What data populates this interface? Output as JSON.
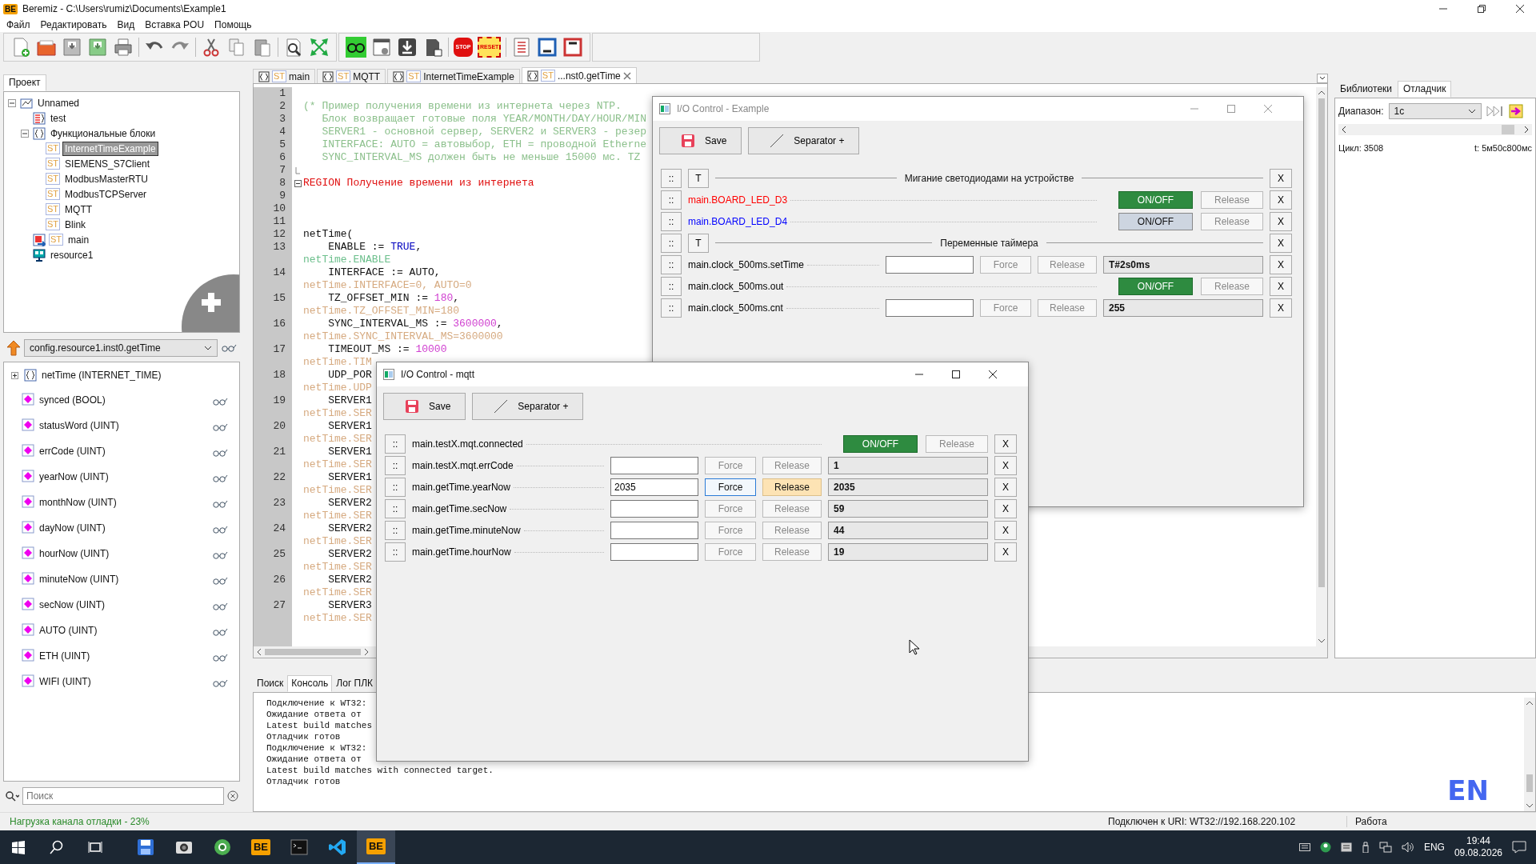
{
  "window": {
    "logo": "BE",
    "title": "Beremiz - C:\\Users\\rumiz\\Documents\\Example1"
  },
  "menu": [
    "Файл",
    "Редактировать",
    "Вид",
    "Вставка POU",
    "Помощь"
  ],
  "toolbar": {
    "stop_label": "STOP",
    "reset_label": "RESET"
  },
  "project_panel": {
    "tab": "Проект",
    "tree": [
      {
        "label": "Unnamed",
        "kind": "plc",
        "selected": false,
        "expanded": true,
        "children": [
          {
            "label": "test",
            "kind": "data",
            "selected": false
          },
          {
            "label": "Функциональные блоки",
            "kind": "folder",
            "selected": false,
            "expanded": true,
            "children": [
              {
                "label": "InternetTimeExample",
                "kind": "st",
                "badge": "ST",
                "selected": true
              },
              {
                "label": "SIEMENS_S7Client",
                "kind": "st",
                "badge": "ST",
                "selected": false
              },
              {
                "label": "ModbusMasterRTU",
                "kind": "st",
                "badge": "ST",
                "selected": false
              },
              {
                "label": "ModbusTCPServer",
                "kind": "st",
                "badge": "ST",
                "selected": false
              },
              {
                "label": "MQTT",
                "kind": "st",
                "badge": "ST",
                "selected": false
              },
              {
                "label": "Blink",
                "kind": "st",
                "badge": "ST",
                "selected": false
              }
            ]
          },
          {
            "label": "main",
            "kind": "program",
            "badge": "ST",
            "selected": false
          },
          {
            "label": "resource1",
            "kind": "resource",
            "selected": false
          }
        ]
      }
    ]
  },
  "instance": {
    "path": "config.resource1.inst0.getTime"
  },
  "variables": [
    {
      "label": "netTime (INTERNET_TIME)",
      "kind": "block",
      "expanded": false
    },
    {
      "label": "synced (BOOL)",
      "kind": "var"
    },
    {
      "label": "statusWord (UINT)",
      "kind": "var"
    },
    {
      "label": "errCode (UINT)",
      "kind": "var"
    },
    {
      "label": "yearNow (UINT)",
      "kind": "var"
    },
    {
      "label": "monthNow (UINT)",
      "kind": "var"
    },
    {
      "label": "dayNow (UINT)",
      "kind": "var"
    },
    {
      "label": "hourNow (UINT)",
      "kind": "var"
    },
    {
      "label": "minuteNow (UINT)",
      "kind": "var"
    },
    {
      "label": "secNow (UINT)",
      "kind": "var"
    },
    {
      "label": "AUTO (UINT)",
      "kind": "var"
    },
    {
      "label": "ETH (UINT)",
      "kind": "var"
    },
    {
      "label": "WIFI (UINT)",
      "kind": "var"
    }
  ],
  "search": {
    "placeholder": "Поиск"
  },
  "editor": {
    "tabs": [
      {
        "label": "main",
        "badge": "ST",
        "selected": false
      },
      {
        "label": "MQTT",
        "badge": "ST",
        "selected": false
      },
      {
        "label": "InternetTimeExample",
        "badge": "ST",
        "selected": false
      },
      {
        "label": "...nst0.getTime",
        "badge": "ST",
        "selected": true
      }
    ],
    "lines": [
      {
        "number": "1"
      },
      {
        "number": "2",
        "segments": [
          {
            "kind": "comment",
            "text": "(* Пример получения времени из интернета через NTP."
          }
        ]
      },
      {
        "number": "3",
        "segments": [
          {
            "kind": "comment",
            "text": "   Блок возвращает готовые поля YEAR/MONTH/DAY/HOUR/MIN"
          }
        ]
      },
      {
        "number": "4",
        "segments": [
          {
            "kind": "comment",
            "text": "   SERVER1 - основной сервер, SERVER2 и SERVER3 - резер"
          }
        ]
      },
      {
        "number": "5",
        "segments": [
          {
            "kind": "comment",
            "text": "   INTERFACE: AUTO = автовыбор, ETH = проводной Etherne"
          }
        ]
      },
      {
        "number": "6",
        "segments": [
          {
            "kind": "comment",
            "text": "   SYNC_INTERVAL_MS должен быть не меньше 15000 мс. TZ"
          }
        ]
      },
      {
        "number": "7",
        "kind": "fold_end"
      },
      {
        "number": "8",
        "kind": "fold_start",
        "segments": [
          {
            "kind": "region",
            "text": "REGION Получение времени из интернета"
          }
        ]
      },
      {
        "number": "9"
      },
      {
        "number": "10"
      },
      {
        "number": "11"
      },
      {
        "number": "12",
        "segments": [
          {
            "kind": "code",
            "text": "netTime("
          }
        ]
      },
      {
        "number": "13",
        "segments": [
          {
            "kind": "code",
            "text": "    ENABLE := "
          },
          {
            "kind": "keyword",
            "text": "TRUE"
          },
          {
            "kind": "code",
            "text": ","
          }
        ],
        "watch": {
          "kind": "bool",
          "text": "netTime.ENABLE"
        }
      },
      {
        "number": "14",
        "segments": [
          {
            "kind": "code",
            "text": "    INTERFACE := AUTO,"
          }
        ],
        "watch": {
          "kind": "value",
          "text": "netTime.INTERFACE=0, AUTO=0"
        }
      },
      {
        "number": "15",
        "segments": [
          {
            "kind": "code",
            "text": "    TZ_OFFSET_MIN := "
          },
          {
            "kind": "number",
            "text": "180"
          },
          {
            "kind": "code",
            "text": ","
          }
        ],
        "watch": {
          "kind": "value",
          "text": "netTime.TZ_OFFSET_MIN=180"
        }
      },
      {
        "number": "16",
        "segments": [
          {
            "kind": "code",
            "text": "    SYNC_INTERVAL_MS := "
          },
          {
            "kind": "number",
            "text": "3600000"
          },
          {
            "kind": "code",
            "text": ","
          }
        ],
        "watch": {
          "kind": "value",
          "text": "netTime.SYNC_INTERVAL_MS=3600000"
        }
      },
      {
        "number": "17",
        "segments": [
          {
            "kind": "code",
            "text": "    TIMEOUT_MS := "
          },
          {
            "kind": "number",
            "text": "10000"
          }
        ],
        "watch": {
          "kind": "value",
          "text": "netTime.TIM"
        }
      },
      {
        "number": "18",
        "segments": [
          {
            "kind": "code",
            "text": "    UDP_POR"
          }
        ],
        "watch": {
          "kind": "value",
          "text": "netTime.UDP"
        }
      },
      {
        "number": "19",
        "segments": [
          {
            "kind": "code",
            "text": "    SERVER1"
          }
        ],
        "watch": {
          "kind": "value",
          "text": "netTime.SER"
        }
      },
      {
        "number": "20",
        "segments": [
          {
            "kind": "code",
            "text": "    SERVER1"
          }
        ],
        "watch": {
          "kind": "value",
          "text": "netTime.SER"
        }
      },
      {
        "number": "21",
        "segments": [
          {
            "kind": "code",
            "text": "    SERVER1"
          }
        ],
        "watch": {
          "kind": "value",
          "text": "netTime.SER"
        }
      },
      {
        "number": "22",
        "segments": [
          {
            "kind": "code",
            "text": "    SERVER1"
          }
        ],
        "watch": {
          "kind": "value",
          "text": "netTime.SER"
        }
      },
      {
        "number": "23",
        "segments": [
          {
            "kind": "code",
            "text": "    SERVER2"
          }
        ],
        "watch": {
          "kind": "value",
          "text": "netTime.SER"
        }
      },
      {
        "number": "24",
        "segments": [
          {
            "kind": "code",
            "text": "    SERVER2"
          }
        ],
        "watch": {
          "kind": "value",
          "text": "netTime.SER"
        }
      },
      {
        "number": "25",
        "segments": [
          {
            "kind": "code",
            "text": "    SERVER2"
          }
        ],
        "watch": {
          "kind": "value",
          "text": "netTime.SER"
        }
      },
      {
        "number": "26",
        "segments": [
          {
            "kind": "code",
            "text": "    SERVER2"
          }
        ],
        "watch": {
          "kind": "value",
          "text": "netTime.SER"
        }
      },
      {
        "number": "27",
        "segments": [
          {
            "kind": "code",
            "text": "    SERVER3"
          }
        ],
        "watch": {
          "kind": "value",
          "text": "netTime.SER"
        }
      }
    ]
  },
  "debugger_panel": {
    "tabs": [
      {
        "label": "Библиотеки",
        "selected": false
      },
      {
        "label": "Отладчик",
        "selected": true
      }
    ],
    "range_label": "Диапазон:",
    "range_value": "1с",
    "cycle": "Цикл: 3508",
    "time": "t: 5м50с800мс"
  },
  "io_windows": [
    {
      "title": "I/O Control - Example",
      "save": "Save",
      "separator": "Separator +",
      "rows": [
        {
          "kind": "separator",
          "handle": "::",
          "toggle": "T",
          "title": "Мигание светодиодами на устройстве",
          "remove": "X"
        },
        {
          "kind": "bool",
          "handle": "::",
          "name": "main.BOARD_LED_D3",
          "color": "#ff0000",
          "switch": "ON/OFF",
          "on": true,
          "release": "Release",
          "remove": "X"
        },
        {
          "kind": "bool",
          "handle": "::",
          "name": "main.BOARD_LED_D4",
          "color": "#0000ff",
          "switch": "ON/OFF",
          "on": false,
          "release": "Release",
          "remove": "X"
        },
        {
          "kind": "separator",
          "handle": "::",
          "toggle": "T",
          "title": "Переменные таймера",
          "remove": "X"
        },
        {
          "kind": "value",
          "handle": "::",
          "name": "main.clock_500ms.setTime",
          "color": "#000000",
          "force": "Force",
          "release": "Release",
          "forced": false,
          "value": "T#2s0ms",
          "remove": "X"
        },
        {
          "kind": "bool",
          "handle": "::",
          "name": "main.clock_500ms.out",
          "color": "#000000",
          "switch": "ON/OFF",
          "on": true,
          "release": "Release",
          "remove": "X"
        },
        {
          "kind": "value",
          "handle": "::",
          "name": "main.clock_500ms.cnt",
          "color": "#000000",
          "force": "Force",
          "release": "Release",
          "forced": false,
          "value": "255",
          "remove": "X"
        }
      ]
    },
    {
      "title": "I/O Control - mqtt",
      "save": "Save",
      "separator": "Separator +",
      "rows": [
        {
          "kind": "bool",
          "handle": "::",
          "name": "main.testX.mqt.connected",
          "color": "#000000",
          "switch": "ON/OFF",
          "on": true,
          "release": "Release",
          "remove": "X"
        },
        {
          "kind": "value",
          "handle": "::",
          "name": "main.testX.mqt.errCode",
          "color": "#000000",
          "force": "Force",
          "release": "Release",
          "forced": false,
          "value": "1",
          "remove": "X"
        },
        {
          "kind": "value",
          "handle": "::",
          "name": "main.getTime.yearNow",
          "color": "#000000",
          "input": "2035",
          "force": "Force",
          "release": "Release",
          "forced": true,
          "value": "2035",
          "remove": "X"
        },
        {
          "kind": "value",
          "handle": "::",
          "name": "main.getTime.secNow",
          "color": "#000000",
          "force": "Force",
          "release": "Release",
          "forced": false,
          "value": "59",
          "remove": "X"
        },
        {
          "kind": "value",
          "handle": "::",
          "name": "main.getTime.minuteNow",
          "color": "#000000",
          "force": "Force",
          "release": "Release",
          "forced": false,
          "value": "44",
          "remove": "X"
        },
        {
          "kind": "value",
          "handle": "::",
          "name": "main.getTime.hourNow",
          "color": "#000000",
          "force": "Force",
          "release": "Release",
          "forced": false,
          "value": "19",
          "remove": "X"
        }
      ]
    }
  ],
  "console": {
    "tabs": [
      {
        "label": "Поиск",
        "selected": false
      },
      {
        "label": "Консоль",
        "selected": true
      },
      {
        "label": "Лог ПЛК",
        "selected": false
      }
    ],
    "lines": [
      "Подключение к WT32:",
      "Ожидание ответа от",
      "Latest build matches",
      "Отладчик готов",
      "Подключение к WT32:",
      "Ожидание ответа от",
      "Latest build matches with connected target.",
      "Отладчик готов"
    ],
    "language": "EN"
  },
  "status_bar": {
    "load": "Нагрузка канала отладки - 23%",
    "connection": "Подключен к URI: WT32://192.168.220.102",
    "state": "Работа"
  },
  "taskbar": {
    "apps": [
      {
        "kind": "disk",
        "active": false
      },
      {
        "kind": "camera",
        "active": false
      },
      {
        "kind": "browser",
        "active": false
      },
      {
        "kind": "beremiz",
        "logo": "BE",
        "active": false
      },
      {
        "kind": "terminal",
        "active": false
      },
      {
        "kind": "vscode",
        "active": false
      },
      {
        "kind": "beremiz",
        "logo": "BE",
        "active": true
      }
    ],
    "language": "ENG",
    "time": "19:44",
    "date": "09.08.2026"
  }
}
